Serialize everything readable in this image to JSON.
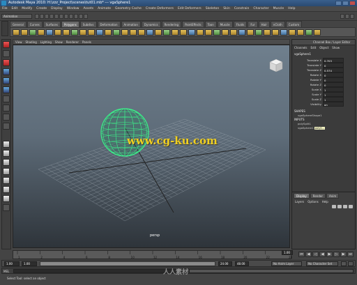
{
  "window": {
    "title": "Autodesk Maya 2010: H:\\zzz_Project\\scenes\\tut01.mb*  ---  vgaSphere1"
  },
  "menubar": {
    "items": [
      "File",
      "Edit",
      "Modify",
      "Create",
      "Display",
      "Window",
      "Assets",
      "Animate",
      "Geometry Cache",
      "Create Deformers",
      "Edit Deformers",
      "Skeleton",
      "Skin",
      "Constrain",
      "Character",
      "Muscle",
      "Help"
    ]
  },
  "statusline": {
    "mode": "Animation"
  },
  "shelf": {
    "tabs": [
      "General",
      "Curves",
      "Surfaces",
      "Polygons",
      "Subdivs",
      "Deformation",
      "Animation",
      "Dynamics",
      "Rendering",
      "PaintEffects",
      "Toon",
      "Muscle",
      "Fluids",
      "Fur",
      "Hair",
      "nCloth",
      "Custom"
    ],
    "active_tab": "Polygons"
  },
  "viewport": {
    "menu": [
      "View",
      "Shading",
      "Lighting",
      "Show",
      "Renderer",
      "Panels"
    ],
    "camera_label": "persp",
    "watermark": "www.cg-ku.com"
  },
  "channel_box": {
    "title": "Channel Box / Layer Editor",
    "menu": [
      "Channels",
      "Edit",
      "Object",
      "Show"
    ],
    "object_name": "vgaSphere1",
    "attributes": [
      {
        "name": "Translate X",
        "value": "0.703"
      },
      {
        "name": "Translate Y",
        "value": "0"
      },
      {
        "name": "Translate Z",
        "value": "0.574"
      },
      {
        "name": "Rotate X",
        "value": "0"
      },
      {
        "name": "Rotate Y",
        "value": "0"
      },
      {
        "name": "Rotate Z",
        "value": "0"
      },
      {
        "name": "Scale X",
        "value": "1"
      },
      {
        "name": "Scale Y",
        "value": "1"
      },
      {
        "name": "Scale Z",
        "value": "1"
      },
      {
        "name": "Visibility",
        "value": "on"
      }
    ],
    "shapes_header": "SHAPES",
    "shape_name": "vgaSphereShape1",
    "inputs_header": "INPUTS",
    "inputs": [
      "polySplit1",
      "vgaSphere1"
    ],
    "input_tooltip": "polyS..."
  },
  "layer_editor": {
    "tabs": [
      "Display",
      "Render",
      "Anim"
    ],
    "active_tab": "Display",
    "menu": [
      "Layers",
      "Options",
      "Help"
    ]
  },
  "timeline": {
    "ticks": [
      "1",
      "2",
      "4",
      "6",
      "8",
      "10",
      "12",
      "14",
      "16",
      "18",
      "20",
      "22",
      "24"
    ],
    "current_frame": "1.00"
  },
  "range": {
    "start": "1.00",
    "playback_start": "1.00",
    "end": "24.00",
    "playback_end": "48.00",
    "anim_layer": "No Anim Layer",
    "char_set": "No Character Set"
  },
  "command_line": {
    "label": "MEL"
  },
  "help_line": {
    "text": "Select Tool: select an object"
  },
  "brand_watermark": {
    "text": "人人素材"
  }
}
